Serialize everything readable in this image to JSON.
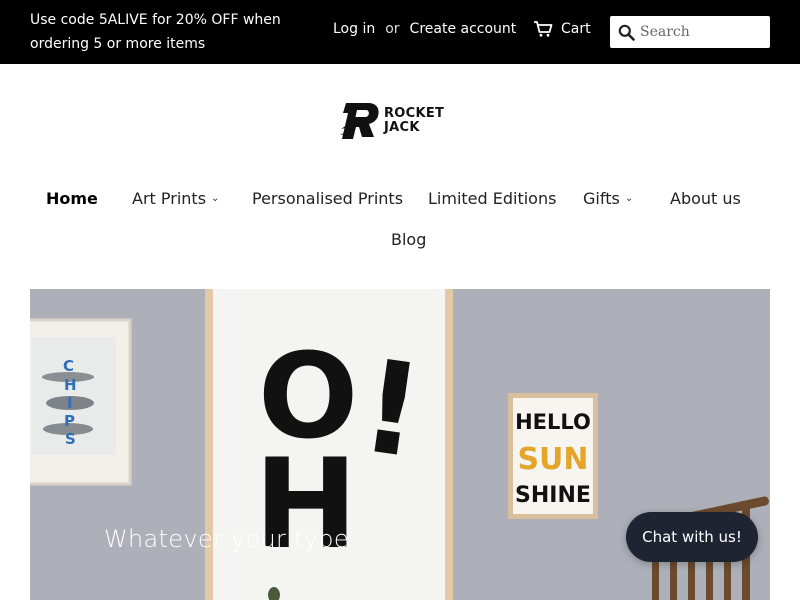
{
  "announcement": {
    "promo_text": "Use code 5ALIVE for 20% OFF when ordering 5 or more items"
  },
  "account": {
    "login_label": "Log in",
    "separator": "or",
    "create_label": "Create account"
  },
  "cart": {
    "label": "Cart",
    "icon": "cart-icon"
  },
  "search": {
    "placeholder": "Search",
    "icon": "search-icon"
  },
  "logo": {
    "line1": "ROCKET",
    "line2": "JACK"
  },
  "nav": {
    "items": [
      {
        "label": "Home",
        "active": true,
        "has_dropdown": false
      },
      {
        "label": "Art Prints",
        "active": false,
        "has_dropdown": true
      },
      {
        "label": "Personalised Prints",
        "active": false,
        "has_dropdown": false
      },
      {
        "label": "Limited Editions",
        "active": false,
        "has_dropdown": false
      },
      {
        "label": "Gifts",
        "active": false,
        "has_dropdown": true
      },
      {
        "label": "About us",
        "active": false,
        "has_dropdown": false
      },
      {
        "label": "Blog",
        "active": false,
        "has_dropdown": false
      }
    ],
    "caret_glyph": "⌄"
  },
  "hero": {
    "caption": "Whatever your type",
    "poster_left_letters": [
      "C",
      "H",
      "I",
      "P",
      "S"
    ],
    "poster_center_letters": [
      "O",
      "H",
      "!"
    ],
    "poster_right_lines": [
      "HELLO",
      "SUN",
      "SHINE"
    ]
  },
  "chat": {
    "label": "Chat with us!"
  },
  "colors": {
    "topbar_bg": "#000000",
    "chat_bg": "#1e2431",
    "sun_accent": "#e3a52a",
    "chips_blue": "#2f6fb8"
  }
}
